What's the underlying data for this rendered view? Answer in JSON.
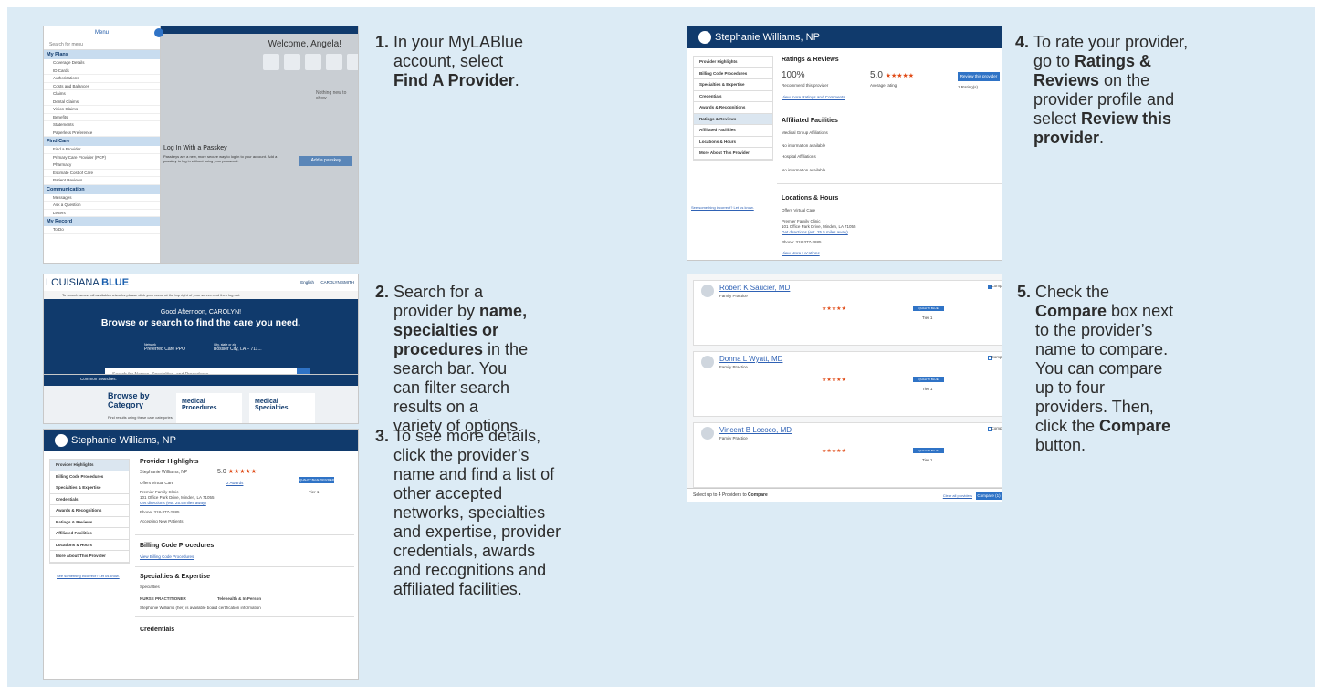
{
  "steps": [
    {
      "num": "1.",
      "parts": [
        "In your MyLABlue account, select ",
        {
          "b": "Find A Provider"
        },
        "."
      ]
    },
    {
      "num": "2.",
      "parts": [
        "Search for a provider by ",
        {
          "b": "name, specialties or procedures"
        },
        " in the search bar. You can filter search results on a variety of options."
      ]
    },
    {
      "num": "3.",
      "parts": [
        "To see more details, click the provider’s name and find a list of other accepted networks, specialties and expertise, provider credentials, awards and recognitions and affiliated facilities."
      ]
    },
    {
      "num": "4.",
      "parts": [
        "To rate your provider, go to ",
        {
          "b": "Ratings & Reviews"
        },
        " on the provider profile and select ",
        {
          "b": "Review this provider"
        },
        "."
      ]
    },
    {
      "num": "5.",
      "parts": [
        "Check the ",
        {
          "b": "Compare"
        },
        " box next to the provider’s name to compare. You can compare up to four providers. Then, click the ",
        {
          "b": "Compare"
        },
        " button."
      ]
    }
  ],
  "shot1": {
    "menu_title": "Menu",
    "search_placeholder": "Search for menu",
    "welcome": "Welcome, Angela!",
    "nothing": "Nothing new to show",
    "passkey_title": "Log In With a Passkey",
    "passkey_text": "Passkeys are a new, more secure way to log in to your account. Add a passkey to log in without using your password.",
    "passkey_btn": "Add a passkey",
    "tiles": [
      "Find a Provider",
      "Messages",
      "Claims",
      "Authorizations",
      "Statements"
    ],
    "sections": [
      {
        "title": "My Plans",
        "items": [
          "Coverage Details",
          "ID Cards",
          "Authorizations",
          "Costs and Balances",
          "Claims",
          "Dental Claims",
          "Vision Claims",
          "Benefits",
          "Statements",
          "Paperless Preference"
        ]
      },
      {
        "title": "Find Care",
        "items": [
          "Find a Provider",
          "Primary Care Provider (PCP)",
          "Pharmacy",
          "Estimate Cost of Care",
          "Patient Reviews"
        ]
      },
      {
        "title": "Communication",
        "items": [
          "Messages",
          "Ask a Question",
          "Letters"
        ]
      },
      {
        "title": "My Record",
        "items": [
          "To Do"
        ]
      }
    ]
  },
  "shot2": {
    "brand_a": "LOUISIANA",
    "brand_b": "BLUE",
    "lang": "English",
    "user": "CAROLYN SMITH",
    "info": "To search across all available networks please click your name at the top right of your screen and then log out.",
    "greeting": "Good Afternoon, CAROLYN!",
    "headline": "Browse or search to find the care you need.",
    "network_label": "Network",
    "network": "Preferred Care PPO",
    "location_label": "City, state or zip",
    "location": "Bossier City, LA – 711...",
    "search_placeholder": "Search for Names, Specialties, and Procedures",
    "search_help": "Search Help",
    "common_label": "Common Searches:",
    "common": [
      "Primary Care",
      "Urgent Care",
      "Behavioral Health",
      "DME & Medical Supplies",
      "Colonoscopy",
      "Mammogram"
    ],
    "browse_title": "Browse by Category",
    "browse_sub": "Find results using these care categories",
    "cards": [
      "Medical Procedures",
      "Medical Specialties"
    ]
  },
  "shot3": {
    "name": "Stephanie Williams, NP",
    "nav": [
      "Provider Highlights",
      "Billing Code Procedures",
      "Specialties & Expertise",
      "Credentials",
      "Awards & Recognitions",
      "Ratings & Reviews",
      "Affiliated Facilities",
      "Locations & Hours",
      "More About This Provider"
    ],
    "incorrect": "See something incorrect? Let us know.",
    "highlights_title": "Provider Highlights",
    "provider": "Stephanie Williams, NP",
    "virtual": "Offers Virtual Care",
    "clinic": "Premier Family Clinic",
    "address": "101 Office Park Drive, Minden, LA 71055",
    "directions": "Get directions (est. 25.5 miles away)",
    "phone": "Phone: 318-377-2885",
    "accepting": "Accepting New Patients",
    "rating": "5.0",
    "awards": "2 Awards",
    "more_network": "More about this provider's network",
    "quality": "QUALITY BLUE PROVIDER",
    "tier": "Tier 1",
    "billing_title": "Billing Code Procedures",
    "billing_link": "View Billing Code Procedures",
    "spec_title": "Specialties & Expertise",
    "spec_label": "Specialties",
    "spec_name": "NURSE PRACTITIONER",
    "spec_mode": "Telehealth & In Person",
    "cert": "Stephanie Williams (her) is available board certification information",
    "cred_title": "Credentials"
  },
  "shot4": {
    "name": "Stephanie Williams, NP",
    "nav": [
      "Provider Highlights",
      "Billing Code Procedures",
      "Specialties & Expertise",
      "Credentials",
      "Awards & Recognitions",
      "Ratings & Reviews",
      "Affiliated Facilities",
      "Locations & Hours",
      "More About This Provider"
    ],
    "incorrect": "See something incorrect? Let us know.",
    "ratings_title": "Ratings & Reviews",
    "pct": "100%",
    "recommend": "Recommend this provider",
    "avg": "5.0",
    "avg_label": "Average rating",
    "count": "1 Rating(s)",
    "review_btn": "Review this provider",
    "view_more": "View more Ratings and Comments",
    "aff_title": "Affiliated Facilities",
    "med_group": "Medical Group Affiliations",
    "no_info": "No information available",
    "hospital": "Hospital Affiliations",
    "loc_title": "Locations & Hours",
    "virtual": "Offers Virtual Care",
    "clinic": "Premier Family Clinic",
    "address": "101 Office Park Drive, Minden, LA 71055",
    "directions": "Get directions (est. 25.5 miles away)",
    "phone": "Phone: 318-377-2885",
    "more_loc": "View More Locations"
  },
  "shot5": {
    "providers": [
      {
        "name": "Robert K Saucier, MD",
        "type": "Family Practice"
      },
      {
        "name": "Donna L Wyatt, MD",
        "type": "Family Practice"
      },
      {
        "name": "Vincent B Lococo, MD",
        "type": "Family Practice"
      }
    ],
    "compare_label": "Compare",
    "footer": "Select up to 4 Providers to",
    "footer_b": "Compare",
    "clear": "Clear all providers",
    "compare_btn": "Compare (1)",
    "quality": "QUALITY BLUE PROVIDER",
    "tier": "Tier 1"
  },
  "colors": {
    "navy": "#103a6c",
    "panel": "#dcebf5",
    "accent": "#2f73c6",
    "star": "#e04b17"
  }
}
